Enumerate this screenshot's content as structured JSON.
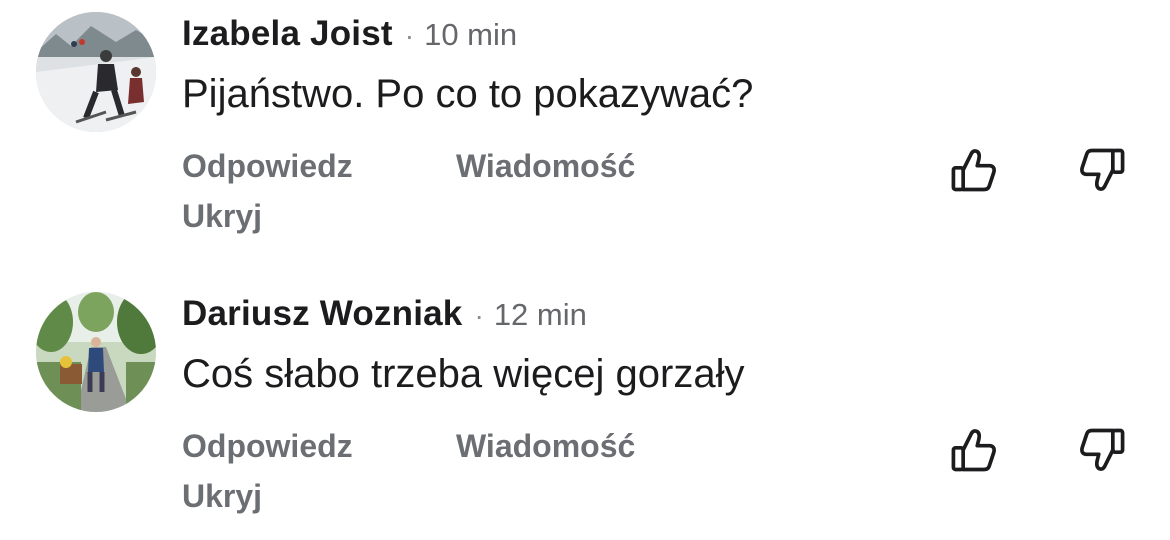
{
  "comments": [
    {
      "author": "Izabela Joist",
      "separator": "·",
      "time": "10 min",
      "text": "Pijaństwo. Po co to pokazywać?",
      "actions": {
        "reply": "Odpowiedz",
        "message": "Wiadomość",
        "hide": "Ukryj"
      },
      "avatar": "skier-photo-avatar"
    },
    {
      "author": "Dariusz Wozniak",
      "separator": "·",
      "time": "12 min",
      "text": "Coś słabo trzeba więcej gorzały",
      "actions": {
        "reply": "Odpowiedz",
        "message": "Wiadomość",
        "hide": "Ukryj"
      },
      "avatar": "park-photo-avatar"
    }
  ],
  "icons": {
    "like": "thumbs-up-icon",
    "dislike": "thumbs-down-icon"
  },
  "colors": {
    "text": "#1c1c1e",
    "secondary": "#65676b",
    "action": "#6b6e72",
    "background": "#ffffff"
  }
}
